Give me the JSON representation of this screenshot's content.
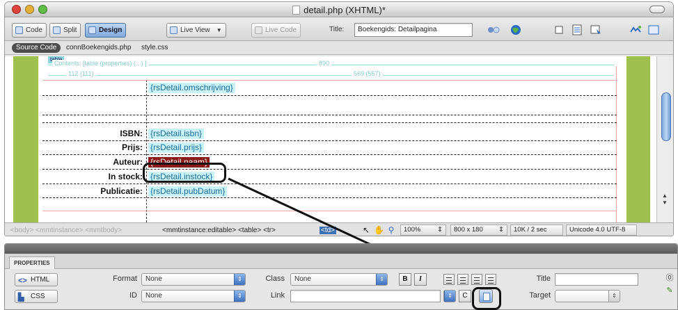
{
  "window": {
    "title": "detail.php (XHTML)*"
  },
  "toolbar": {
    "code_label": "Code",
    "split_label": "Split",
    "design_label": "Design",
    "live_view_label": "Live View",
    "live_code_label": "Live Code",
    "title_label": "Title:",
    "title_value": "Boekengids: Detailpagina"
  },
  "filebar": {
    "source_code": "Source Code",
    "files": [
      "connBoekengids.php",
      "style.css"
    ]
  },
  "design": {
    "tag_tab": "table",
    "dim_outer_left": "Contents: [table  (properties) (...) ]",
    "dim_outer_right": "890",
    "dim_inner_left": "112 (111)",
    "dim_inner_right": "569 (557)",
    "rows": [
      {
        "label": "",
        "binding": "{rsDetail.omschrijving}"
      },
      {
        "label": "ISBN:",
        "binding": "{rsDetail.isbn}"
      },
      {
        "label": "Prijs:",
        "binding": "{rsDetail.prijs}"
      },
      {
        "label": "Auteur:",
        "binding": "{rsDetail.naam}"
      },
      {
        "label": "In stock:",
        "binding": "{rsDetail.instock}"
      },
      {
        "label": "Publicatie:",
        "binding": "{rsDetail.pubDatum}"
      }
    ],
    "selected_binding_color": "#8b1a1a",
    "binding_bg": "#c9f3f7",
    "strip_color": "#9fc04e"
  },
  "statusbar": {
    "faded_crumbs": "<body> <mmtinstance> <mmtbody>",
    "tags": "<mmtinstance:editable> <table> <tr>",
    "selected_tag": "<td>",
    "zoom": "100%",
    "size": "800 x 180",
    "download": "10K / 2 sec",
    "encoding": "Unicode 4.0 UTF-8"
  },
  "properties": {
    "panel_title": "PROPERTIES",
    "html_label": "HTML",
    "css_label": "CSS",
    "format_label": "Format",
    "format_value": "None",
    "class_label": "Class",
    "class_value": "None",
    "id_label": "ID",
    "id_value": "None",
    "link_label": "Link",
    "title_label": "Title",
    "target_label": "Target",
    "bold_label": "B",
    "italic_label": "I"
  }
}
